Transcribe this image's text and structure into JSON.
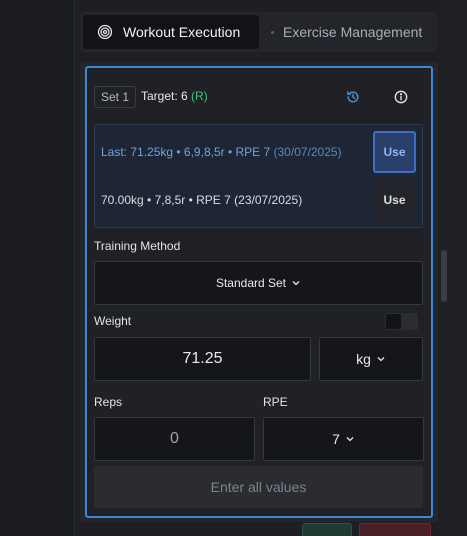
{
  "tabs": [
    {
      "label": "Workout Execution",
      "icon": "target-icon",
      "active": true
    },
    {
      "label": "Exercise Management",
      "active": false
    }
  ],
  "set": {
    "badge": "Set 1",
    "target_prefix": "Target: 6",
    "target_suffix": "(R)",
    "history_icon": "history-icon",
    "info_icon": "info-icon"
  },
  "history": {
    "last_label": "Last: 71.25kg • 6,9,8,5r • RPE 7",
    "last_date": "(30/07/2025)",
    "prev_label": "70.00kg • 7,8,5r • RPE 7",
    "prev_date": "(23/07/2025)",
    "use_label": "Use"
  },
  "training_method": {
    "label": "Training Method",
    "value": "Standard Set"
  },
  "weight": {
    "label": "Weight",
    "value": "71.25",
    "unit": "kg"
  },
  "reps": {
    "label": "Reps",
    "value": "0"
  },
  "rpe": {
    "label": "RPE",
    "value": "7"
  },
  "submit_label": "Enter all values",
  "colors": {
    "accent": "#3f88d6",
    "target_r": "#3ac47d",
    "history_text": "#6fa3dc"
  }
}
